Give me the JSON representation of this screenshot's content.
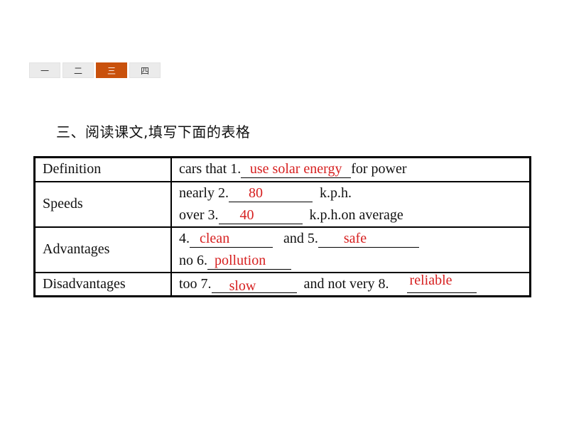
{
  "tabs": [
    {
      "label": "一",
      "active": false
    },
    {
      "label": "二",
      "active": false
    },
    {
      "label": "三",
      "active": true
    },
    {
      "label": "四",
      "active": false
    }
  ],
  "heading": "三、阅读课文,填写下面的表格",
  "table": {
    "rows": [
      {
        "label": "Definition",
        "lines": [
          {
            "pre": "cars that 1.",
            "answer": "use solar energy",
            "post": "for power"
          }
        ]
      },
      {
        "label": "Speeds",
        "lines": [
          {
            "pre": "nearly 2.",
            "answer": "80",
            "post": "k.p.h."
          },
          {
            "pre": "over 3.",
            "answer": "40",
            "post": "k.p.h.on average"
          }
        ]
      },
      {
        "label": "Advantages",
        "lines": [
          {
            "pre": "4.",
            "answer": "clean",
            "mid": "and 5.",
            "answer2": "safe"
          },
          {
            "pre": "no 6.",
            "answer": "pollution"
          }
        ]
      },
      {
        "label": "Disadvantages",
        "lines": [
          {
            "pre": "too 7.",
            "answer": "slow",
            "mid": "and not very 8.",
            "answer2": "reliable"
          }
        ]
      }
    ]
  },
  "colors": {
    "active_tab": "#c9510c",
    "answer": "#d61f1f"
  }
}
